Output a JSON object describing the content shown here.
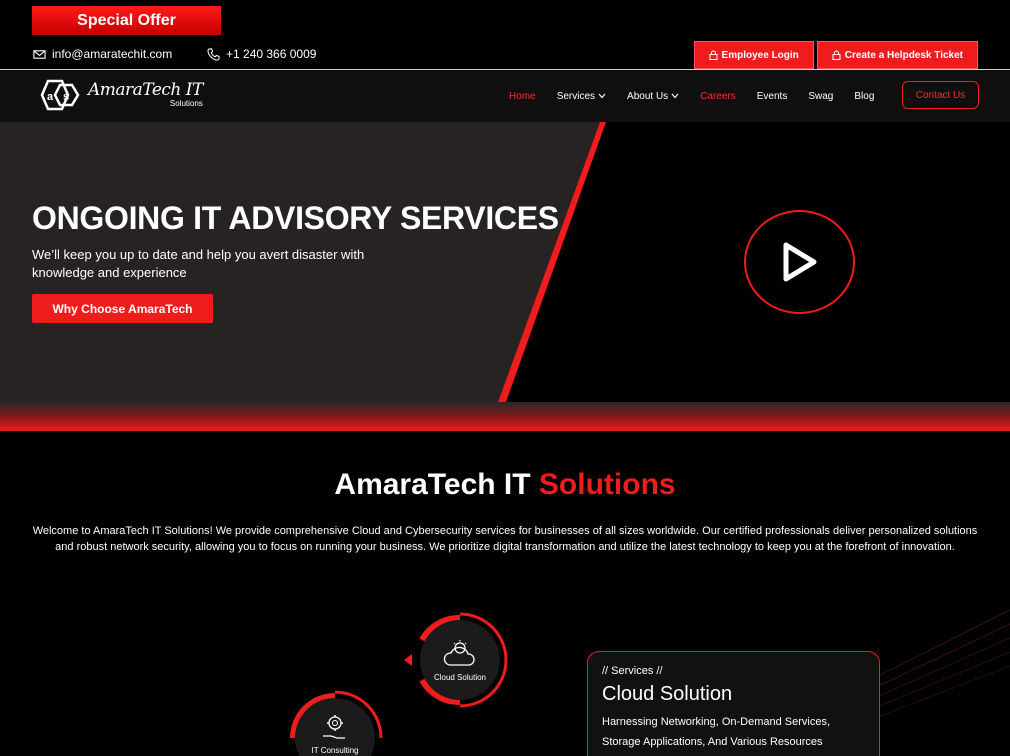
{
  "topbar": {
    "offer_label": "Special Offer",
    "email": "info@amaratechit.com",
    "phone": "+1 240 366 0009",
    "employee_login": "Employee Login",
    "helpdesk": "Create a Helpdesk Ticket"
  },
  "nav": {
    "logo_name": "AmaraTech IT",
    "logo_sub": "Solutions",
    "items": [
      {
        "label": "Home",
        "state": "active"
      },
      {
        "label": "Services",
        "dropdown": true
      },
      {
        "label": "About Us",
        "dropdown": true
      },
      {
        "label": "Careers",
        "state": "highlight"
      },
      {
        "label": "Events"
      },
      {
        "label": "Swag"
      },
      {
        "label": "Blog"
      }
    ],
    "contact_label": "Contact Us"
  },
  "hero": {
    "title": "ONGOING IT ADVISORY SERVICES",
    "subtitle": "We’ll keep you up to date and help you avert disaster with knowledge and experience",
    "button_label": "Why Choose AmaraTech"
  },
  "about": {
    "title_main": "AmaraTech IT ",
    "title_accent": "Solutions",
    "text": "Welcome to AmaraTech IT Solutions! We provide comprehensive Cloud and Cybersecurity services for businesses of all sizes worldwide. Our certified professionals deliver personalized solutions and robust network security, allowing you to focus on running your business. We prioritize digital transformation and utilize the latest technology to keep you at the forefront of innovation."
  },
  "services": {
    "circles": [
      {
        "label": "Cloud Solution",
        "icon": "cloud-bulb-icon"
      },
      {
        "label": "IT Consulting",
        "icon": "gear-hand-icon"
      }
    ],
    "card": {
      "tag": "// Services //",
      "title": "Cloud Solution",
      "description": "Harnessing Networking, On-Demand Services, Storage Applications, And Various Resources"
    }
  },
  "colors": {
    "accent": "#ee1c1c",
    "background": "#000000",
    "panel": "#1b1b1b"
  }
}
